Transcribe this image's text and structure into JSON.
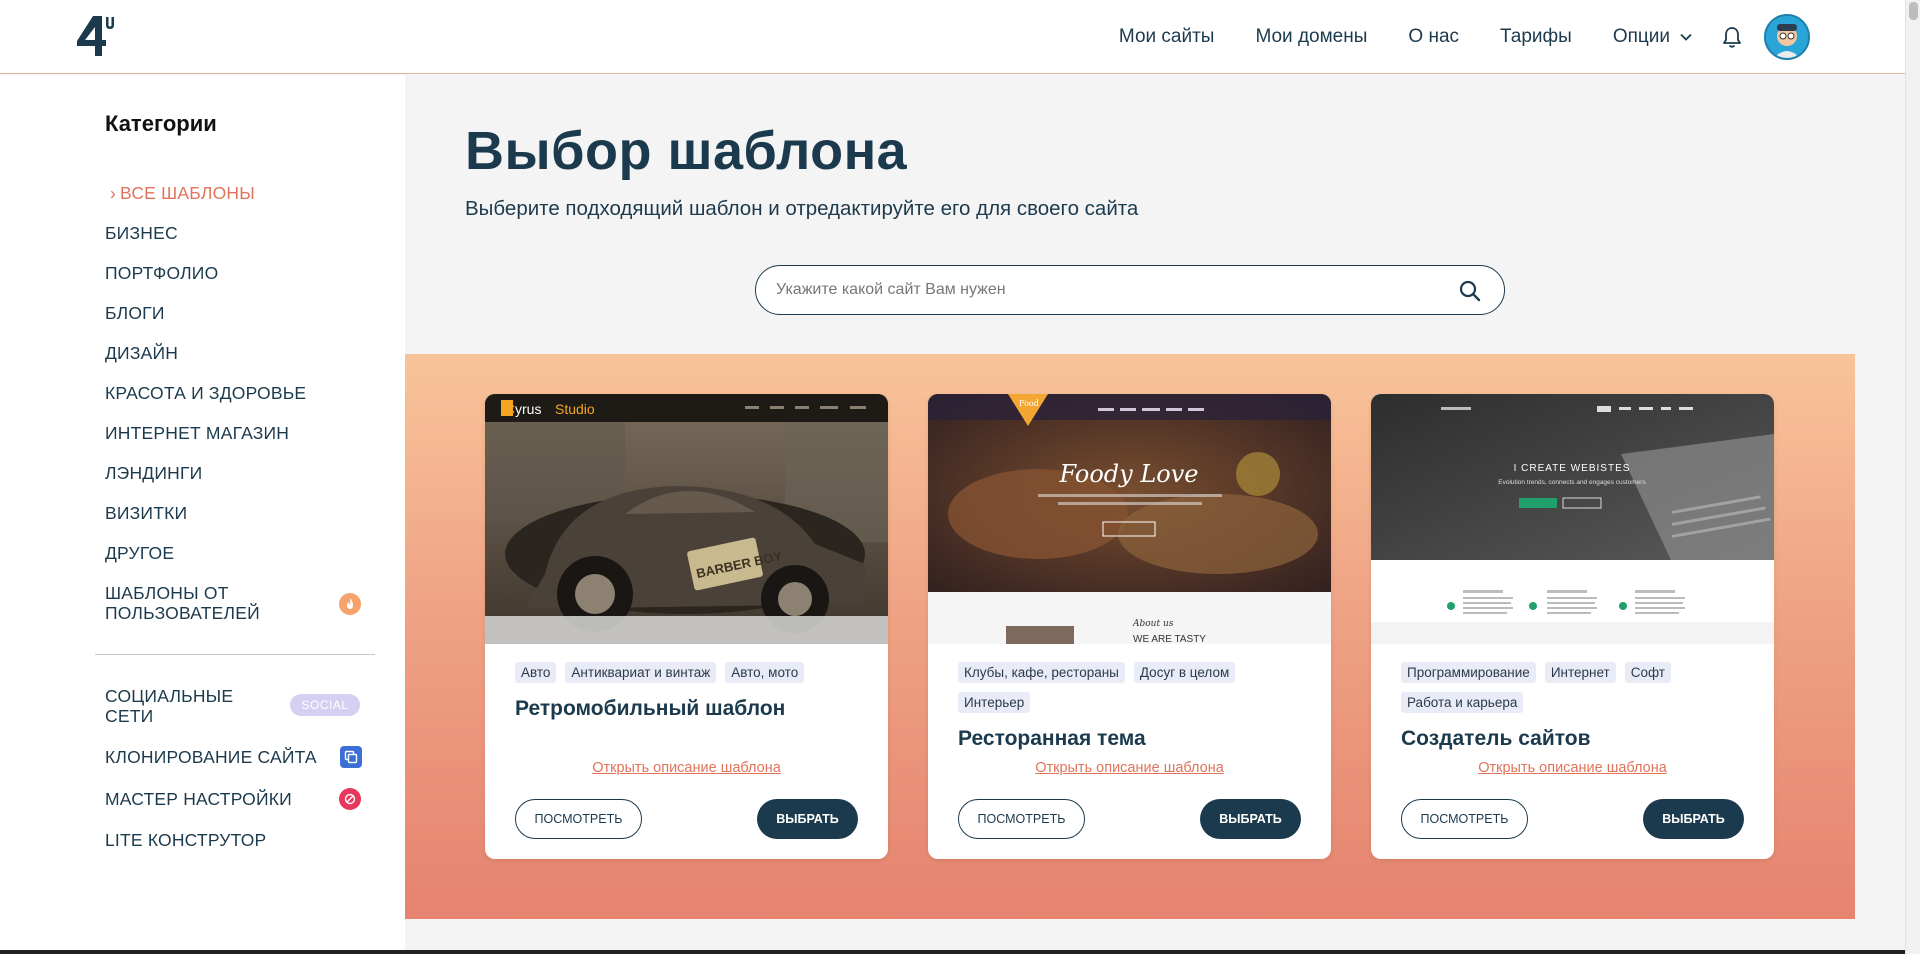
{
  "header": {
    "logo_text": "4u",
    "nav": [
      {
        "label": "Мои сайты"
      },
      {
        "label": "Мои домены"
      },
      {
        "label": "О нас"
      },
      {
        "label": "Тарифы"
      },
      {
        "label": "Опции"
      }
    ],
    "icons": {
      "options_dropdown": "chevron-down-icon",
      "notifications": "bell-icon",
      "avatar": "avatar"
    }
  },
  "sidebar": {
    "heading": "Категории",
    "items": [
      {
        "label": "ВСЕ ШАБЛОНЫ",
        "active": true
      },
      {
        "label": "БИЗНЕС"
      },
      {
        "label": "ПОРТФОЛИО"
      },
      {
        "label": "БЛОГИ"
      },
      {
        "label": "ДИЗАЙН"
      },
      {
        "label": "КРАСОТА И ЗДОРОВЬЕ"
      },
      {
        "label": "ИНТЕРНЕТ МАГАЗИН"
      },
      {
        "label": "ЛЭНДИНГИ"
      },
      {
        "label": "ВИЗИТКИ"
      },
      {
        "label": "ДРУГОЕ"
      },
      {
        "label_line1": "ШАБЛОНЫ ОТ",
        "label_line2": "ПОЛЬЗОВАТЕЛЕЙ",
        "icon": "fire-icon"
      }
    ],
    "extra": [
      {
        "label_line1": "СОЦИАЛЬНЫЕ",
        "label_line2": "СЕТИ",
        "badge": "SOCIAL"
      },
      {
        "label": "КЛОНИРОВАНИЕ САЙТА",
        "icon": "copy-icon"
      },
      {
        "label": "МАСТЕР НАСТРОЙКИ",
        "icon": "wizard-icon"
      },
      {
        "label": "LITE КОНСТРУТОР"
      }
    ]
  },
  "main": {
    "title": "Выбор шаблона",
    "subtitle": "Выберите подходящий шаблон и отредактируйте его для своего сайта",
    "search": {
      "placeholder": "Укажите какой сайт Вам нужен",
      "value": ""
    }
  },
  "cards": [
    {
      "tags": [
        "Авто",
        "Антиквариат и винтаж",
        "Авто, мото"
      ],
      "title": "Ретромобильный шаблон",
      "desc_link": "Открыть описание шаблона",
      "view_label": "ПОСМОТРЕТЬ",
      "choose_label": "ВЫБРАТЬ",
      "preview": {
        "brand": "Cyrus Studio",
        "brand_first": "C",
        "brand_rest": "yrus",
        "brand_accent": "Studio",
        "plate": "BARBER BOY"
      }
    },
    {
      "tags": [
        "Клубы, кафе, рестораны",
        "Досуг в целом",
        "Интерьер"
      ],
      "title": "Ресторанная тема",
      "desc_link": "Открыть описание шаблона",
      "view_label": "ПОСМОТРЕТЬ",
      "choose_label": "ВЫБРАТЬ",
      "preview": {
        "hero": "Foody Love",
        "about": "About us",
        "tasty": "WE ARE TASTY",
        "badge": "Food"
      }
    },
    {
      "tags": [
        "Программирование",
        "Интернет",
        "Софт",
        "Работа и карьера"
      ],
      "title": "Создатель сайтов",
      "desc_link": "Открыть описание шаблона",
      "view_label": "ПОСМОТРЕТЬ",
      "choose_label": "ВЫБРАТЬ",
      "preview": {
        "hero": "I CREATE WEBISTES",
        "sub": "Evolution trends, connects and engages customers"
      }
    }
  ],
  "colors": {
    "accent": "#e0745b",
    "primary": "#1c3a4d",
    "social_badge": "#d5cff2",
    "fire": "#f5a26b",
    "copy": "#3b6fd6",
    "wizard": "#e8375c"
  }
}
